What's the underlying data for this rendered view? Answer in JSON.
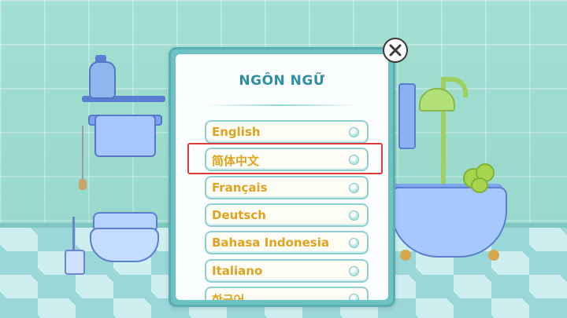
{
  "dialog": {
    "title": "NGÔN NGỮ",
    "close_icon": "close-icon",
    "options": [
      {
        "label": "English",
        "icon": "radio-icon"
      },
      {
        "label": "简体中文",
        "icon": "radio-icon",
        "highlighted": true
      },
      {
        "label": "Français",
        "icon": "radio-icon"
      },
      {
        "label": "Deutsch",
        "icon": "radio-icon"
      },
      {
        "label": "Bahasa Indonesia",
        "icon": "radio-icon"
      },
      {
        "label": "Italiano",
        "icon": "radio-icon"
      },
      {
        "label": "한국어",
        "icon": "radio-icon"
      }
    ]
  },
  "colors": {
    "accent_label": "#e0a321",
    "title": "#2e8ea6",
    "highlight_box": "#e23a3a",
    "panel_border": "#6ec3c2"
  }
}
